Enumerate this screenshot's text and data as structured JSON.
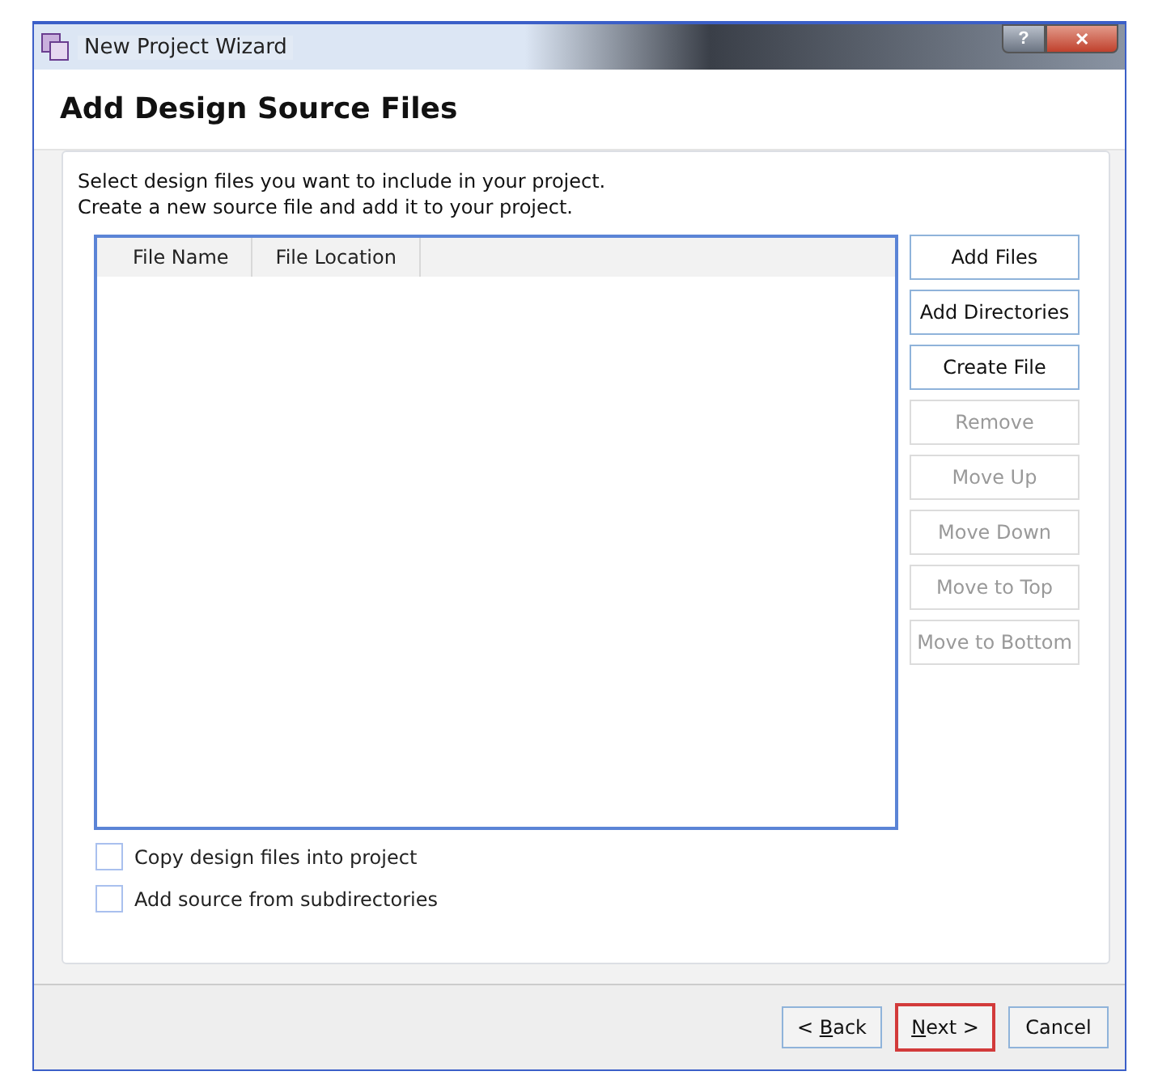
{
  "window": {
    "title": "New Project Wizard",
    "controls": [
      {
        "kind": "help",
        "label": "?"
      },
      {
        "kind": "close",
        "label": "✕"
      }
    ]
  },
  "page_title": "Add Design Source Files",
  "description": [
    "Select design files you want to include in your project.",
    "Create a new source file and add it to your project."
  ],
  "table": {
    "columns": [
      "File Name",
      "File Location"
    ]
  },
  "side_buttons": [
    {
      "label": "Add Files",
      "disabled": false
    },
    {
      "label": "Add Directories",
      "disabled": false
    },
    {
      "label": "Create File",
      "disabled": false
    },
    {
      "label": "Remove",
      "disabled": true
    },
    {
      "label": "Move Up",
      "disabled": true
    },
    {
      "label": "Move Down",
      "disabled": true
    },
    {
      "label": "Move to Top",
      "disabled": true
    },
    {
      "label": "Move to Bottom",
      "disabled": true
    }
  ],
  "options": [
    {
      "label": "Copy design files into project",
      "checked": false
    },
    {
      "label": "Add source from subdirectories",
      "checked": false
    }
  ],
  "footer_buttons": [
    {
      "before": "< ",
      "key": "B",
      "after": "ack",
      "highlighted": false
    },
    {
      "key": "N",
      "after": "ext >",
      "highlighted": true
    },
    {
      "after": "Cancel",
      "highlighted": false
    }
  ]
}
